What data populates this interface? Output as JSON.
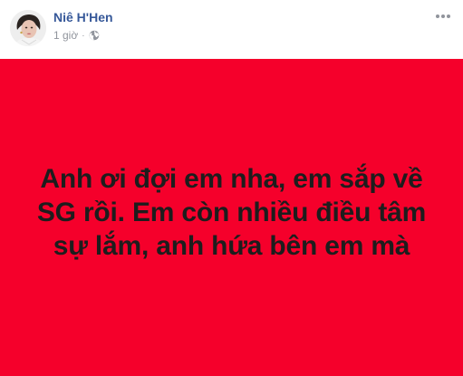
{
  "post": {
    "author": "Niê H'Hen",
    "timestamp": "1 giờ",
    "separator": "·",
    "privacy_icon": "globe-icon",
    "options_icon": "more-horizontal-icon",
    "status_text": "Anh ơi đợi em nha, em sắp về SG rồi. Em còn nhiều điều tâm sự lắm, anh hứa bên em mà",
    "background_color": "#f5002b",
    "text_color": "#1d1d1d"
  },
  "colors": {
    "author_link": "#365899",
    "meta_gray": "#90949c"
  }
}
